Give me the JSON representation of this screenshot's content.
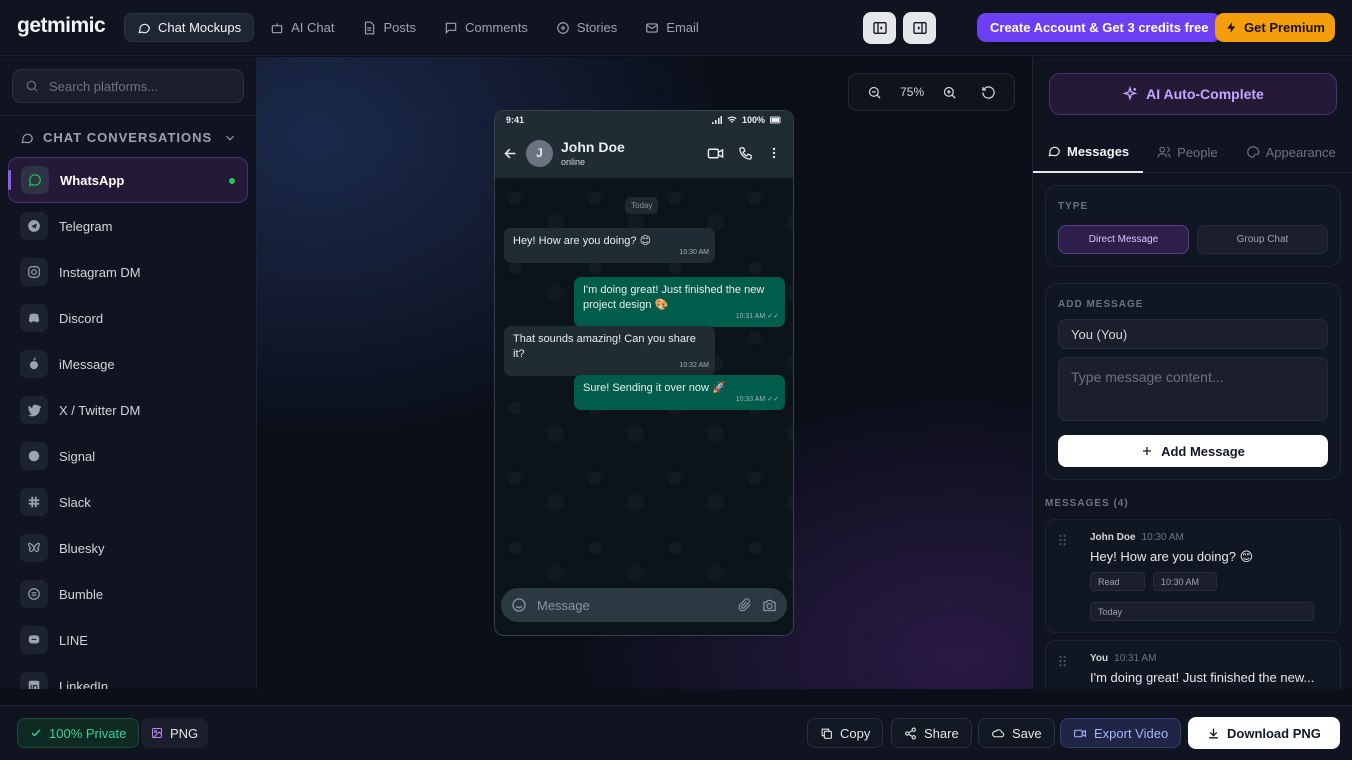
{
  "app": {
    "logo": "getmimic"
  },
  "nav": {
    "items": [
      "Chat Mockups",
      "AI Chat",
      "Posts",
      "Comments",
      "Stories",
      "Email"
    ]
  },
  "header": {
    "create_account": "Create Account & Get 3 credits free",
    "premium": "Get Premium"
  },
  "sidebar": {
    "search_placeholder": "Search platforms...",
    "section_title": "CHAT CONVERSATIONS",
    "platforms": [
      "WhatsApp",
      "Telegram",
      "Instagram DM",
      "Discord",
      "iMessage",
      "X / Twitter DM",
      "Signal",
      "Slack",
      "Bluesky",
      "Bumble",
      "LINE",
      "LinkedIn"
    ],
    "active": "WhatsApp"
  },
  "canvas": {
    "zoom": "75%"
  },
  "phone": {
    "time": "9:41",
    "battery": "100%",
    "contact_initial": "J",
    "contact_name": "John Doe",
    "contact_status": "online",
    "day_label": "Today",
    "messages": [
      {
        "text": "Hey! How are you doing? 😊",
        "time": "10:30 AM",
        "dir": "in"
      },
      {
        "text": "I'm doing great! Just finished the new project design 🎨",
        "time": "10:31 AM",
        "dir": "out"
      },
      {
        "text": "That sounds amazing! Can you share it?",
        "time": "10:32 AM",
        "dir": "in"
      },
      {
        "text": "Sure! Sending it over now 🚀",
        "time": "10:33 AM",
        "dir": "out"
      }
    ],
    "composer_placeholder": "Message"
  },
  "right_panel": {
    "ai_button": "AI Auto-Complete",
    "tabs": [
      "Messages",
      "People",
      "Appearance"
    ],
    "type_label": "TYPE",
    "type_options": [
      "Direct Message",
      "Group Chat"
    ],
    "add_message_label": "ADD MESSAGE",
    "sender_value": "You (You)",
    "content_placeholder": "Type message content...",
    "add_button": "Add Message",
    "messages_header": "MESSAGES (4)",
    "message_list": [
      {
        "sender": "John Doe",
        "time": "10:30 AM",
        "text": "Hey! How are you doing? 😊",
        "status": "Read",
        "time_field": "10:30 AM",
        "day_field": "Today"
      },
      {
        "sender": "You",
        "time": "10:31 AM",
        "text": "I'm doing great! Just finished the new..."
      }
    ]
  },
  "bottom": {
    "private": "100% Private",
    "format": "PNG",
    "copy": "Copy",
    "share": "Share",
    "save": "Save",
    "export_video": "Export Video",
    "download": "Download PNG"
  },
  "colors": {
    "accent": "#6d3ff2",
    "premium": "#f59e0b",
    "whatsapp_out": "#005c4b",
    "whatsapp_in": "#202c33",
    "online": "#22c55e"
  }
}
